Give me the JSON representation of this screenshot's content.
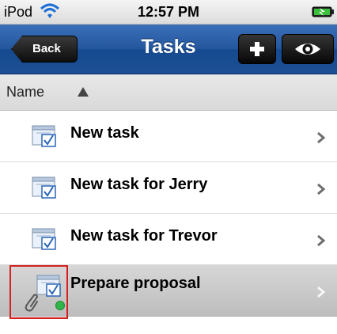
{
  "status_bar": {
    "device": "iPod",
    "time": "12:57 PM"
  },
  "nav_bar": {
    "back_label": "Back",
    "title": "Tasks"
  },
  "sort_header": {
    "label": "Name"
  },
  "tasks": [
    {
      "name": "New task"
    },
    {
      "name": "New task for Jerry"
    },
    {
      "name": "New task for Trevor"
    },
    {
      "name": "Prepare proposal"
    }
  ],
  "colors": {
    "nav_blue": "#23569d",
    "highlight_red": "#d62020",
    "status_green": "#31b54a"
  }
}
